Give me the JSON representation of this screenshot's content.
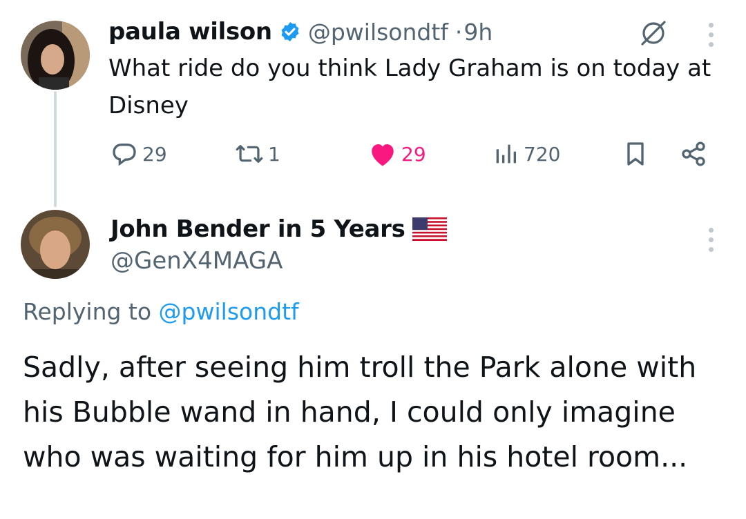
{
  "tweet": {
    "author_name": "paula wilson",
    "author_handle": "@pwilsondtf",
    "separator": "·",
    "time": "9h",
    "text": "What ride do you think Lady Graham is on today at Disney",
    "stats": {
      "replies": "29",
      "retweets": "1",
      "likes": "29",
      "views": "720"
    },
    "colors": {
      "like": "#f91880",
      "verified": "#1d9bf0",
      "meta": "#536471"
    },
    "icons": [
      "verified-badge-icon",
      "grok-icon",
      "more-icon",
      "reply-icon",
      "retweet-icon",
      "heart-icon",
      "views-icon",
      "bookmark-icon",
      "share-icon"
    ]
  },
  "reply": {
    "author_name": "John Bender in 5 Years",
    "author_handle": "@GenX4MAGA",
    "flag_icon": "us-flag-icon",
    "replying_prefix": "Replying to",
    "replying_to": "@pwilsondtf",
    "text": "Sadly, after seeing him troll the Park alone with his Bubble wand in hand, I could only imagine who was waiting for him up in his hotel room...",
    "colors": {
      "link": "#1d9bf0"
    }
  }
}
